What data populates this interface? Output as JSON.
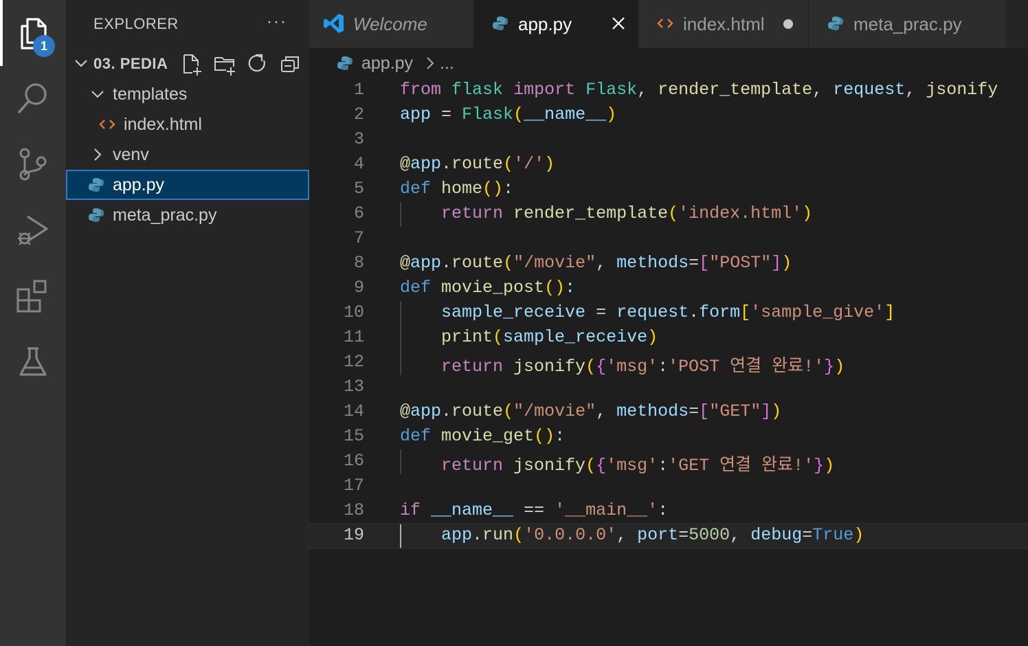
{
  "activity_bar": {
    "items": [
      {
        "name": "explorer",
        "icon": "files-icon",
        "badge": "1"
      },
      {
        "name": "search",
        "icon": "search-icon"
      },
      {
        "name": "source-control",
        "icon": "source-control-icon"
      },
      {
        "name": "run-debug",
        "icon": "run-debug-icon"
      },
      {
        "name": "extensions",
        "icon": "extensions-icon"
      },
      {
        "name": "testing",
        "icon": "beaker-icon"
      }
    ]
  },
  "sidebar": {
    "title": "EXPLORER",
    "more": "···",
    "folder": "03. PEDIA",
    "tree": [
      {
        "label": "templates",
        "type": "folder-open"
      },
      {
        "label": "index.html",
        "type": "html"
      },
      {
        "label": "venv",
        "type": "folder-closed"
      },
      {
        "label": "app.py",
        "type": "python",
        "selected": true
      },
      {
        "label": "meta_prac.py",
        "type": "python"
      }
    ]
  },
  "tabs": [
    {
      "label": "Welcome",
      "icon": "vscode-icon"
    },
    {
      "label": "app.py",
      "icon": "python-icon",
      "active": true
    },
    {
      "label": "index.html",
      "icon": "html-icon",
      "modified": true
    },
    {
      "label": "meta_prac.py",
      "icon": "python-icon"
    }
  ],
  "breadcrumb": {
    "file": "app.py",
    "more": "..."
  },
  "editor": {
    "current_line": 19,
    "lines": [
      [
        [
          "kw",
          "from"
        ],
        [
          "op",
          " "
        ],
        [
          "cls",
          "flask"
        ],
        [
          "op",
          " "
        ],
        [
          "kw",
          "import"
        ],
        [
          "op",
          " "
        ],
        [
          "cls",
          "Flask"
        ],
        [
          "op",
          ", "
        ],
        [
          "fn",
          "render_template"
        ],
        [
          "op",
          ", "
        ],
        [
          "var",
          "request"
        ],
        [
          "op",
          ", "
        ],
        [
          "fn",
          "jsonify"
        ]
      ],
      [
        [
          "var",
          "app"
        ],
        [
          "op",
          " = "
        ],
        [
          "cls",
          "Flask"
        ],
        [
          "br1",
          "("
        ],
        [
          "var",
          "__name__"
        ],
        [
          "br1",
          ")"
        ]
      ],
      [],
      [
        [
          "dec",
          "@"
        ],
        [
          "var",
          "app"
        ],
        [
          "op",
          "."
        ],
        [
          "fn",
          "route"
        ],
        [
          "br1",
          "("
        ],
        [
          "str",
          "'/'"
        ],
        [
          "br1",
          ")"
        ]
      ],
      [
        [
          "def",
          "def"
        ],
        [
          "op",
          " "
        ],
        [
          "fn",
          "home"
        ],
        [
          "br1",
          "()"
        ],
        [
          "op",
          ":"
        ]
      ],
      [
        [
          "op",
          "    "
        ],
        [
          "kw",
          "return"
        ],
        [
          "op",
          " "
        ],
        [
          "fn",
          "render_template"
        ],
        [
          "br1",
          "("
        ],
        [
          "str",
          "'index.html'"
        ],
        [
          "br1",
          ")"
        ]
      ],
      [],
      [
        [
          "dec",
          "@"
        ],
        [
          "var",
          "app"
        ],
        [
          "op",
          "."
        ],
        [
          "fn",
          "route"
        ],
        [
          "br1",
          "("
        ],
        [
          "str",
          "\"/movie\""
        ],
        [
          "op",
          ", "
        ],
        [
          "var",
          "methods"
        ],
        [
          "op",
          "="
        ],
        [
          "br2",
          "["
        ],
        [
          "str",
          "\"POST\""
        ],
        [
          "br2",
          "]"
        ],
        [
          "br1",
          ")"
        ]
      ],
      [
        [
          "def",
          "def"
        ],
        [
          "op",
          " "
        ],
        [
          "fn",
          "movie_post"
        ],
        [
          "br1",
          "()"
        ],
        [
          "op",
          ":"
        ]
      ],
      [
        [
          "op",
          "    "
        ],
        [
          "var",
          "sample_receive"
        ],
        [
          "op",
          " = "
        ],
        [
          "var",
          "request"
        ],
        [
          "op",
          "."
        ],
        [
          "var",
          "form"
        ],
        [
          "br1",
          "["
        ],
        [
          "str",
          "'sample_give'"
        ],
        [
          "br1",
          "]"
        ]
      ],
      [
        [
          "op",
          "    "
        ],
        [
          "fn",
          "print"
        ],
        [
          "br1",
          "("
        ],
        [
          "var",
          "sample_receive"
        ],
        [
          "br1",
          ")"
        ]
      ],
      [
        [
          "op",
          "    "
        ],
        [
          "kw",
          "return"
        ],
        [
          "op",
          " "
        ],
        [
          "fn",
          "jsonify"
        ],
        [
          "br1",
          "("
        ],
        [
          "br2",
          "{"
        ],
        [
          "str",
          "'msg'"
        ],
        [
          "op",
          ":"
        ],
        [
          "str",
          "'POST 연결 완료!'"
        ],
        [
          "br2",
          "}"
        ],
        [
          "br1",
          ")"
        ]
      ],
      [],
      [
        [
          "dec",
          "@"
        ],
        [
          "var",
          "app"
        ],
        [
          "op",
          "."
        ],
        [
          "fn",
          "route"
        ],
        [
          "br1",
          "("
        ],
        [
          "str",
          "\"/movie\""
        ],
        [
          "op",
          ", "
        ],
        [
          "var",
          "methods"
        ],
        [
          "op",
          "="
        ],
        [
          "br2",
          "["
        ],
        [
          "str",
          "\"GET\""
        ],
        [
          "br2",
          "]"
        ],
        [
          "br1",
          ")"
        ]
      ],
      [
        [
          "def",
          "def"
        ],
        [
          "op",
          " "
        ],
        [
          "fn",
          "movie_get"
        ],
        [
          "br1",
          "()"
        ],
        [
          "op",
          ":"
        ]
      ],
      [
        [
          "op",
          "    "
        ],
        [
          "kw",
          "return"
        ],
        [
          "op",
          " "
        ],
        [
          "fn",
          "jsonify"
        ],
        [
          "br1",
          "("
        ],
        [
          "br2",
          "{"
        ],
        [
          "str",
          "'msg'"
        ],
        [
          "op",
          ":"
        ],
        [
          "str",
          "'GET 연결 완료!'"
        ],
        [
          "br2",
          "}"
        ],
        [
          "br1",
          ")"
        ]
      ],
      [],
      [
        [
          "kw",
          "if"
        ],
        [
          "op",
          " "
        ],
        [
          "var",
          "__name__"
        ],
        [
          "op",
          " == "
        ],
        [
          "str",
          "'__main__'"
        ],
        [
          "op",
          ":"
        ]
      ],
      [
        [
          "op",
          "    "
        ],
        [
          "var",
          "app"
        ],
        [
          "op",
          "."
        ],
        [
          "fn",
          "run"
        ],
        [
          "br1",
          "("
        ],
        [
          "str",
          "'0.0.0.0'"
        ],
        [
          "op",
          ", "
        ],
        [
          "var",
          "port"
        ],
        [
          "op",
          "="
        ],
        [
          "num",
          "5000"
        ],
        [
          "op",
          ", "
        ],
        [
          "var",
          "debug"
        ],
        [
          "op",
          "="
        ],
        [
          "def",
          "True"
        ],
        [
          "br1",
          ")"
        ]
      ]
    ]
  },
  "colors": {
    "activity_bg": "#333333",
    "sidebar_bg": "#252526",
    "editor_bg": "#1e1e1e",
    "badge": "#2f78c4",
    "selection_outline": "#2b79d0",
    "python_icon": "#519aba",
    "html_icon": "#e37933",
    "vscode_icon": "#1f9cf0"
  }
}
